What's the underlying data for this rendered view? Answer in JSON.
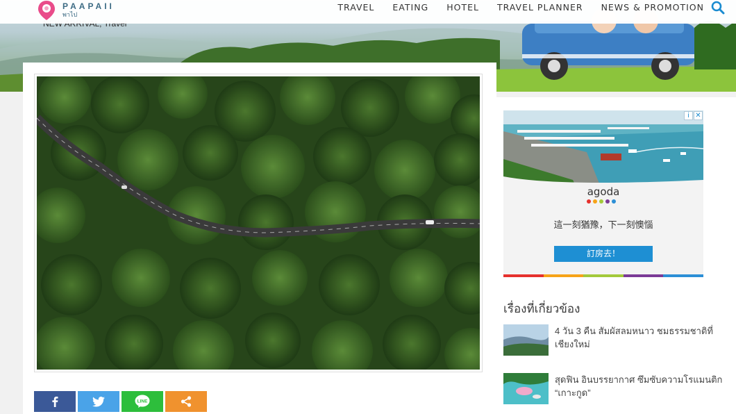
{
  "brand": {
    "name_en": "PAAPAII",
    "name_th": "พาไป",
    "pin_color": "#e94c8a"
  },
  "nav": {
    "items": [
      {
        "label": "TRAVEL"
      },
      {
        "label": "EATING"
      },
      {
        "label": "HOTEL"
      },
      {
        "label": "TRAVEL PLANNER"
      },
      {
        "label": "NEWS & PROMOTION"
      }
    ],
    "search_icon": "search-icon",
    "accent": "#1a8bd0"
  },
  "category_label": "NEW ARRIVAL, Travel",
  "share": {
    "buttons": [
      {
        "name": "facebook",
        "icon": "facebook-icon",
        "color": "#3b5998"
      },
      {
        "name": "twitter",
        "icon": "twitter-icon",
        "color": "#4aa3e8"
      },
      {
        "name": "line",
        "icon": "line-icon",
        "label": "LINE",
        "color": "#2dbe3c"
      },
      {
        "name": "share",
        "icon": "share-icon",
        "color": "#f0922e"
      }
    ]
  },
  "ad": {
    "brand": "agoda",
    "tagline": "這一刻猶豫，下一刻懊惱",
    "cta": "訂房去！",
    "close_info": "i",
    "close_x": "✕"
  },
  "related": {
    "title": "เรื่องที่เกี่ยวข้อง",
    "items": [
      {
        "title": "4 วัน 3 คืน สัมผัสลมหนาว ชมธรรมชาติที่เชียงใหม่"
      },
      {
        "title": "สุดฟิน อินบรรยากาศ ซึมซับความโรแมนติก “เกาะกูด”"
      }
    ]
  }
}
